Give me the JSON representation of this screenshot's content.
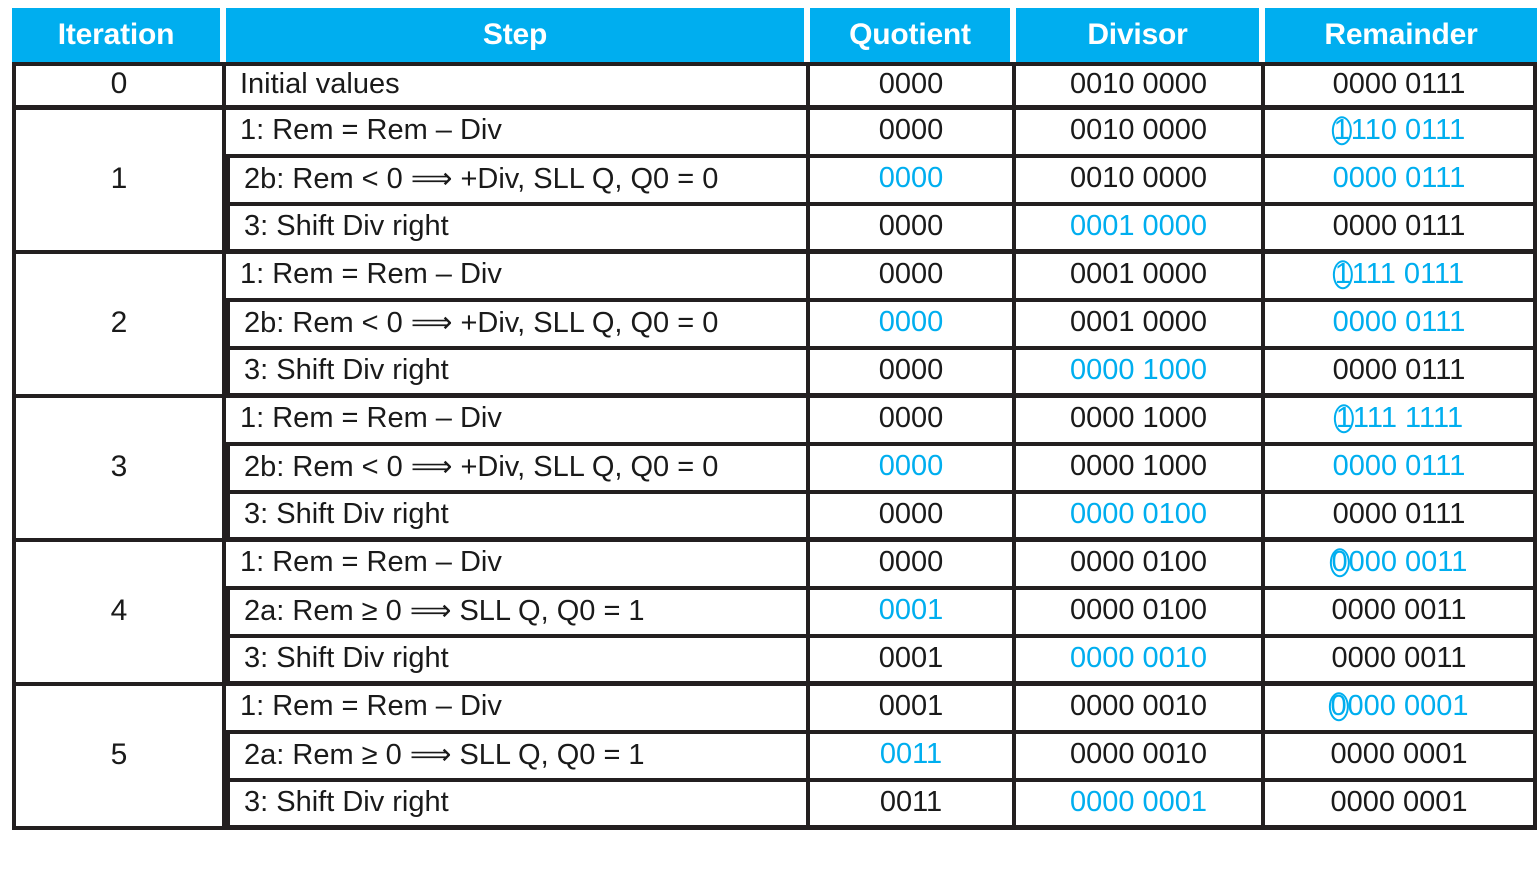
{
  "table": {
    "columns": [
      {
        "key": "iteration",
        "label": "Iteration"
      },
      {
        "key": "step",
        "label": "Step"
      },
      {
        "key": "quotient",
        "label": "Quotient"
      },
      {
        "key": "divisor",
        "label": "Divisor"
      },
      {
        "key": "remainder",
        "label": "Remainder"
      }
    ],
    "colors": {
      "header_background": "#00AEEF",
      "header_text": "#FFFFFF",
      "highlight": "#00AEEF",
      "text": "#1A1A1A",
      "border": "#231F20"
    },
    "steps": {
      "initial": "Initial values",
      "sub": "1:  Rem = Rem – Div",
      "neg": "2b:  Rem < 0 ⟹ +Div, SLL Q, Q0 = 0",
      "pos": "2a:  Rem ≥ 0 ⟹ SLL Q, Q0 = 1",
      "shift": "3:  Shift Div right"
    },
    "iterations": [
      {
        "label": "0"
      },
      {
        "label": "1"
      },
      {
        "label": "2"
      },
      {
        "label": "3"
      },
      {
        "label": "4"
      },
      {
        "label": "5"
      }
    ],
    "rows": [
      {
        "iteration": "0",
        "step": "Initial values",
        "quotient": "0000",
        "divisor": "0010 0000",
        "remainder": "0000 0111",
        "remainder_circled": "",
        "remainder_rest": "0000 0111"
      },
      {
        "iteration": "1",
        "step": "1:  Rem = Rem – Div",
        "quotient": "0000",
        "divisor": "0010 0000",
        "remainder": "1110 0111",
        "remainder_circled": "1",
        "remainder_rest": "110 0111"
      },
      {
        "iteration": "1",
        "step": "2b:  Rem < 0 ⟹ +Div, SLL Q, Q0 = 0",
        "quotient": "0000",
        "divisor": "0010 0000",
        "remainder": "0000 0111",
        "remainder_circled": "",
        "remainder_rest": "0000 0111"
      },
      {
        "iteration": "1",
        "step": "3:  Shift Div right",
        "quotient": "0000",
        "divisor": "0001 0000",
        "remainder": "0000 0111",
        "remainder_circled": "",
        "remainder_rest": "0000 0111"
      },
      {
        "iteration": "2",
        "step": "1:  Rem = Rem – Div",
        "quotient": "0000",
        "divisor": "0001 0000",
        "remainder": "1111 0111",
        "remainder_circled": "1",
        "remainder_rest": "111 0111"
      },
      {
        "iteration": "2",
        "step": "2b:  Rem < 0 ⟹ +Div, SLL Q, Q0 = 0",
        "quotient": "0000",
        "divisor": "0001 0000",
        "remainder": "0000 0111",
        "remainder_circled": "",
        "remainder_rest": "0000 0111"
      },
      {
        "iteration": "2",
        "step": "3:  Shift Div right",
        "quotient": "0000",
        "divisor": "0000 1000",
        "remainder": "0000 0111",
        "remainder_circled": "",
        "remainder_rest": "0000 0111"
      },
      {
        "iteration": "3",
        "step": "1:  Rem = Rem – Div",
        "quotient": "0000",
        "divisor": "0000 1000",
        "remainder": "1111 1111",
        "remainder_circled": "1",
        "remainder_rest": "111 1111"
      },
      {
        "iteration": "3",
        "step": "2b:  Rem < 0 ⟹ +Div, SLL Q, Q0 = 0",
        "quotient": "0000",
        "divisor": "0000 1000",
        "remainder": "0000 0111",
        "remainder_circled": "",
        "remainder_rest": "0000 0111"
      },
      {
        "iteration": "3",
        "step": "3:  Shift Div right",
        "quotient": "0000",
        "divisor": "0000 0100",
        "remainder": "0000 0111",
        "remainder_circled": "",
        "remainder_rest": "0000 0111"
      },
      {
        "iteration": "4",
        "step": "1:  Rem = Rem – Div",
        "quotient": "0000",
        "divisor": "0000 0100",
        "remainder": "0000 0011",
        "remainder_circled": "0",
        "remainder_rest": "000 0011"
      },
      {
        "iteration": "4",
        "step": "2a:  Rem ≥ 0 ⟹ SLL Q, Q0 = 1",
        "quotient": "0001",
        "divisor": "0000 0100",
        "remainder": "0000 0011",
        "remainder_circled": "",
        "remainder_rest": "0000 0011"
      },
      {
        "iteration": "4",
        "step": "3:  Shift Div right",
        "quotient": "0001",
        "divisor": "0000 0010",
        "remainder": "0000 0011",
        "remainder_circled": "",
        "remainder_rest": "0000 0011"
      },
      {
        "iteration": "5",
        "step": "1:  Rem = Rem – Div",
        "quotient": "0001",
        "divisor": "0000 0010",
        "remainder": "0000 0001",
        "remainder_circled": "0",
        "remainder_rest": "000 0001"
      },
      {
        "iteration": "5",
        "step": "2a:  Rem ≥ 0 ⟹ SLL Q, Q0 = 1",
        "quotient": "0011",
        "divisor": "0000 0010",
        "remainder": "0000 0001",
        "remainder_circled": "",
        "remainder_rest": "0000 0001"
      },
      {
        "iteration": "5",
        "step": "3:  Shift Div right",
        "quotient": "0011",
        "divisor": "0000 0001",
        "remainder": "0000 0001",
        "remainder_circled": "",
        "remainder_rest": "0000 0001"
      }
    ],
    "highlight_map": [
      {
        "quotient": false,
        "divisor": false,
        "remainder": false
      },
      {
        "quotient": false,
        "divisor": false,
        "remainder": true
      },
      {
        "quotient": true,
        "divisor": false,
        "remainder": true
      },
      {
        "quotient": false,
        "divisor": true,
        "remainder": false
      },
      {
        "quotient": false,
        "divisor": false,
        "remainder": true
      },
      {
        "quotient": true,
        "divisor": false,
        "remainder": true
      },
      {
        "quotient": false,
        "divisor": true,
        "remainder": false
      },
      {
        "quotient": false,
        "divisor": false,
        "remainder": true
      },
      {
        "quotient": true,
        "divisor": false,
        "remainder": true
      },
      {
        "quotient": false,
        "divisor": true,
        "remainder": false
      },
      {
        "quotient": false,
        "divisor": false,
        "remainder": true
      },
      {
        "quotient": true,
        "divisor": false,
        "remainder": false
      },
      {
        "quotient": false,
        "divisor": true,
        "remainder": false
      },
      {
        "quotient": false,
        "divisor": false,
        "remainder": true
      },
      {
        "quotient": true,
        "divisor": false,
        "remainder": false
      },
      {
        "quotient": false,
        "divisor": true,
        "remainder": false
      }
    ],
    "iteration_spans": [
      {
        "label": "0",
        "row_index": 0,
        "span": 1
      },
      {
        "label": "1",
        "row_index": 1,
        "span": 3
      },
      {
        "label": "2",
        "row_index": 4,
        "span": 3
      },
      {
        "label": "3",
        "row_index": 7,
        "span": 3
      },
      {
        "label": "4",
        "row_index": 10,
        "span": 3
      },
      {
        "label": "5",
        "row_index": 13,
        "span": 3
      }
    ]
  }
}
